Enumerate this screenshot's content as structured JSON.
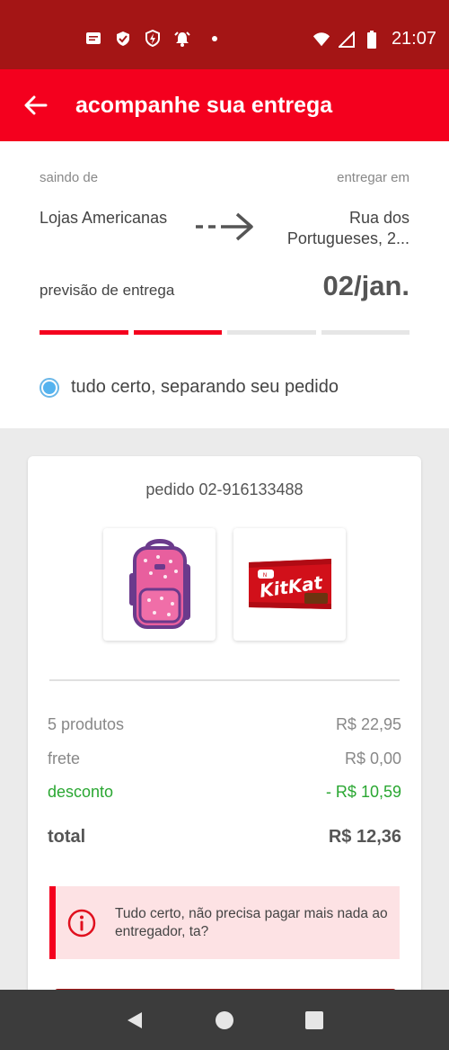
{
  "status_bar": {
    "time": "21:07",
    "left_icons": [
      "message-icon",
      "shield-check-icon",
      "shield-bolt-icon",
      "alarm-icon",
      "dot-icon"
    ],
    "right_icons": [
      "wifi-icon",
      "signal-icon",
      "battery-icon"
    ]
  },
  "app_bar": {
    "title": "acompanhe sua entrega",
    "back_icon": "arrow-left-icon",
    "background": "#f4001e"
  },
  "tracking": {
    "from_label": "saindo de",
    "from_value": "Lojas Americanas",
    "to_label": "entregar em",
    "to_value": "Rua dos Portugueses, 2...",
    "forecast_label": "previsão de entrega",
    "forecast_date": "02/jan.",
    "progress_steps_done": 2,
    "progress_steps_total": 4,
    "status_text": "tudo certo, separando seu pedido",
    "status_color": "#55b3ef"
  },
  "order": {
    "title": "pedido 02-916133488",
    "products": [
      {
        "name": "backpack-image"
      },
      {
        "name": "kitkat-image"
      }
    ],
    "summary": {
      "products_label": "5 produtos",
      "products_value": "R$ 22,95",
      "shipping_label": "frete",
      "shipping_value": "R$ 0,00",
      "discount_label": "desconto",
      "discount_value": "- R$ 10,59",
      "total_label": "total",
      "total_value": "R$ 12,36"
    },
    "notice": {
      "icon": "info-icon",
      "text": "Tudo certo, não precisa pagar mais nada ao entregador, ta?"
    }
  },
  "nav_bar": {
    "buttons": [
      "back-triangle-icon",
      "home-circle-icon",
      "recents-square-icon"
    ]
  },
  "colors": {
    "brand_red": "#f4001e",
    "status_bar": "#a41515",
    "discount_green": "#2aa732",
    "notice_bg": "#fde2e4"
  }
}
